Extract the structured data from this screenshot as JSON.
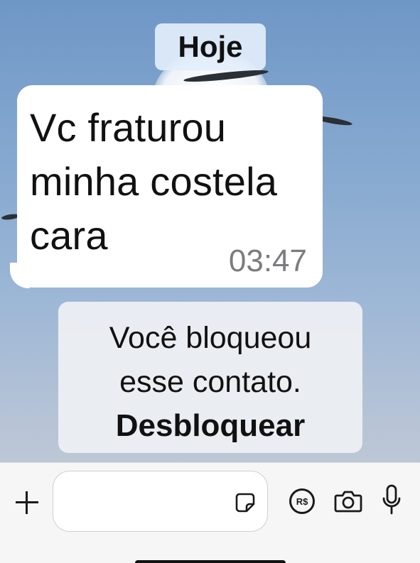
{
  "chat": {
    "date_label": "Hoje",
    "message": {
      "text": "Vc fraturou\nminha costela\ncara",
      "time": "03:47"
    },
    "system_notice": {
      "line1": "Você bloqueou",
      "line2": "esse contato.",
      "action": "Desbloquear"
    }
  },
  "composer": {
    "input_value": "",
    "icons": [
      "plus-icon",
      "sticker-icon",
      "payment-icon",
      "camera-icon",
      "microphone-icon"
    ],
    "payment_label": "R$"
  },
  "colors": {
    "bubble": "#ffffff",
    "time": "#7c7c80",
    "composer_bg": "#f6f6f6"
  }
}
